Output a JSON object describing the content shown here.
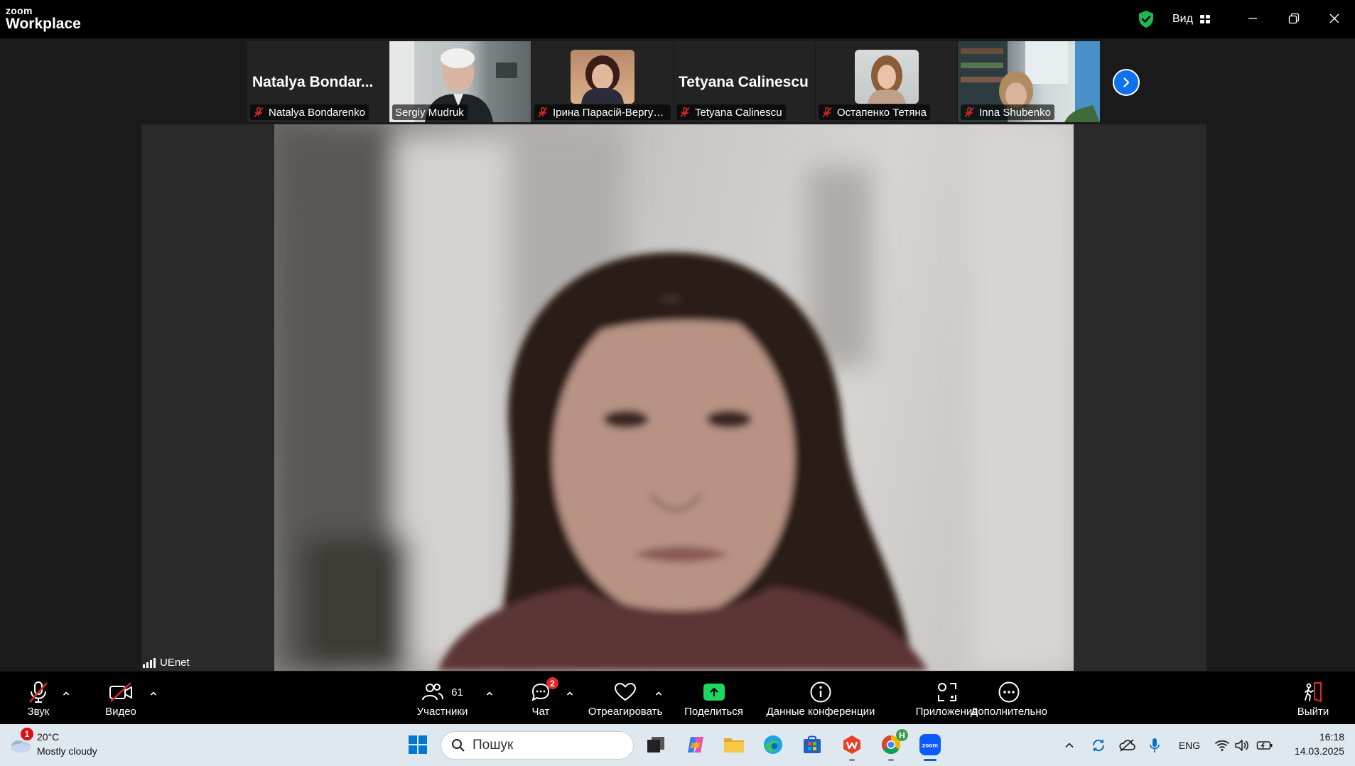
{
  "app": {
    "brand_small": "zoom",
    "brand_big": "Workplace",
    "view_label": "Вид"
  },
  "colors": {
    "accent": "#0e72ed",
    "share_green": "#1ed760",
    "mute_red": "#e02828",
    "shield_green": "#1db954"
  },
  "participants_strip": [
    {
      "name": "Natalya Bondarenko",
      "big_name": "Natalya Bondar...",
      "muted": true,
      "has_video": false
    },
    {
      "name": "Sergiy Mudruk",
      "muted": false,
      "has_video": true
    },
    {
      "name": "Ірина Парасій-Вергун...",
      "muted": true,
      "has_video": true
    },
    {
      "name": "Tetyana Calinescu",
      "big_name": "Tetyana Calinescu",
      "muted": true,
      "has_video": false
    },
    {
      "name": "Остапенко Тетяна",
      "muted": true,
      "has_video": true
    },
    {
      "name": "Inna Shubenko",
      "muted": true,
      "has_video": true
    }
  ],
  "main_video": {
    "name": "UEnet"
  },
  "toolbar": {
    "audio": "Звук",
    "video": "Видео",
    "participants": "Участники",
    "participants_count": "61",
    "chat": "Чат",
    "chat_badge": "2",
    "react": "Отреагировать",
    "share": "Поделиться",
    "info": "Данные конференции",
    "apps": "Приложения",
    "more": "Дополнительно",
    "leave": "Выйти"
  },
  "taskbar": {
    "weather_temp": "20°C",
    "weather_desc": "Mostly cloudy",
    "weather_badge": "1",
    "search_placeholder": "Пошук",
    "language": "ENG",
    "time": "16:18",
    "date": "14.03.2025",
    "chrome_badge": "H"
  }
}
